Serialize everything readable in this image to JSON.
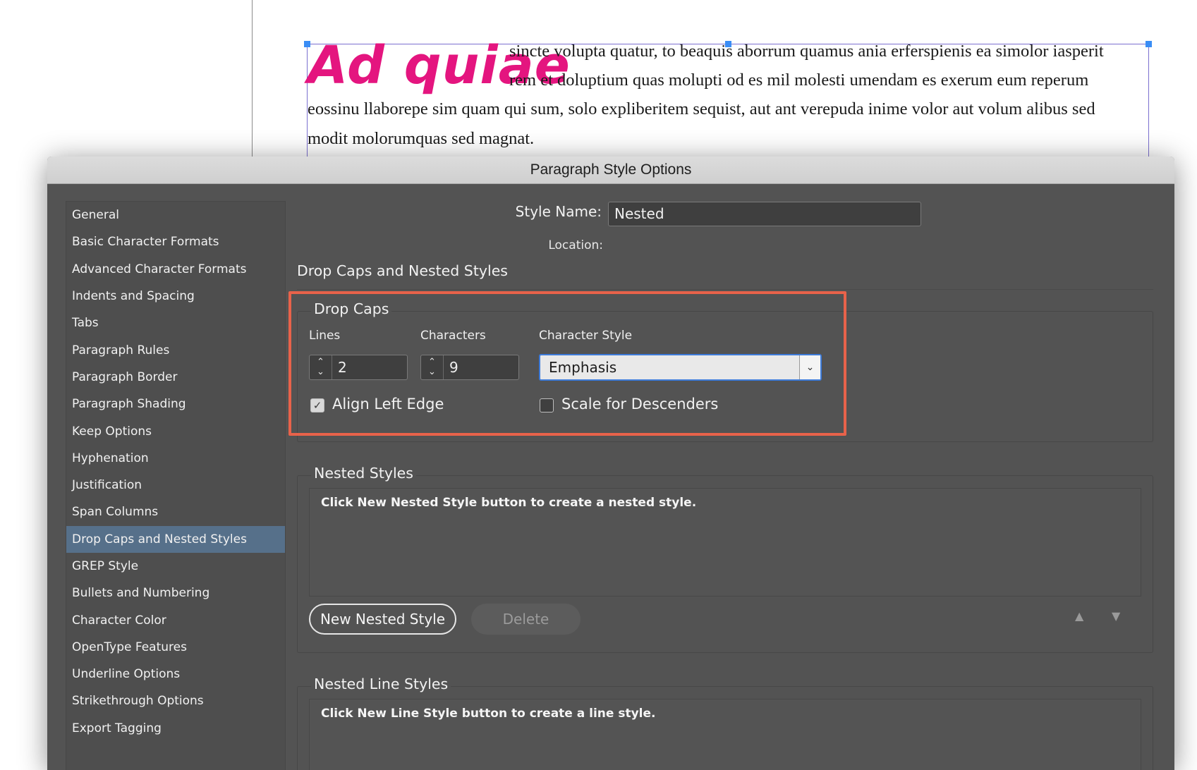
{
  "document": {
    "drop_cap": "Ad quiae",
    "lines": [
      "sincte volupta quatur, to beaquis aborrum quamus ania erferspienis ea simolor iasperit",
      "rem et doluptium quas molupti od es mil molesti umendam es exerum eum reperum",
      "eossinu llaborepe sim quam qui sum, solo expliberitem sequist, aut ant verepuda inime volor aut volum alibus sed",
      "modit molorumquas sed magnat."
    ]
  },
  "dialog": {
    "title": "Paragraph Style Options",
    "style_name_label": "Style Name:",
    "style_name_value": "Nested",
    "location_label": "Location:",
    "section_heading": "Drop Caps and Nested Styles"
  },
  "sidebar": {
    "items": [
      {
        "label": "General"
      },
      {
        "label": "Basic Character Formats"
      },
      {
        "label": "Advanced Character Formats"
      },
      {
        "label": "Indents and Spacing"
      },
      {
        "label": "Tabs"
      },
      {
        "label": "Paragraph Rules"
      },
      {
        "label": "Paragraph Border"
      },
      {
        "label": "Paragraph Shading"
      },
      {
        "label": "Keep Options"
      },
      {
        "label": "Hyphenation"
      },
      {
        "label": "Justification"
      },
      {
        "label": "Span Columns"
      },
      {
        "label": "Drop Caps and Nested Styles",
        "selected": true
      },
      {
        "label": "GREP Style"
      },
      {
        "label": "Bullets and Numbering"
      },
      {
        "label": "Character Color"
      },
      {
        "label": "OpenType Features"
      },
      {
        "label": "Underline Options"
      },
      {
        "label": "Strikethrough Options"
      },
      {
        "label": "Export Tagging"
      }
    ]
  },
  "drop_caps": {
    "title": "Drop Caps",
    "lines_label": "Lines",
    "lines_value": "2",
    "characters_label": "Characters",
    "characters_value": "9",
    "char_style_label": "Character Style",
    "char_style_value": "Emphasis",
    "align_left_edge_label": "Align Left Edge",
    "align_left_edge_checked": true,
    "scale_descenders_label": "Scale for Descenders",
    "scale_descenders_checked": false
  },
  "nested_styles": {
    "title": "Nested Styles",
    "hint": "Click New Nested Style button to create a nested style.",
    "new_button": "New Nested Style",
    "delete_button": "Delete"
  },
  "nested_line_styles": {
    "title": "Nested Line Styles",
    "hint": "Click New Line Style button to create a line style."
  },
  "colors": {
    "drop_cap_color": "#e4157f",
    "highlight_box": "#e8624a",
    "selection_blue": "#3d7bd9",
    "sidebar_selected": "#56708a"
  }
}
